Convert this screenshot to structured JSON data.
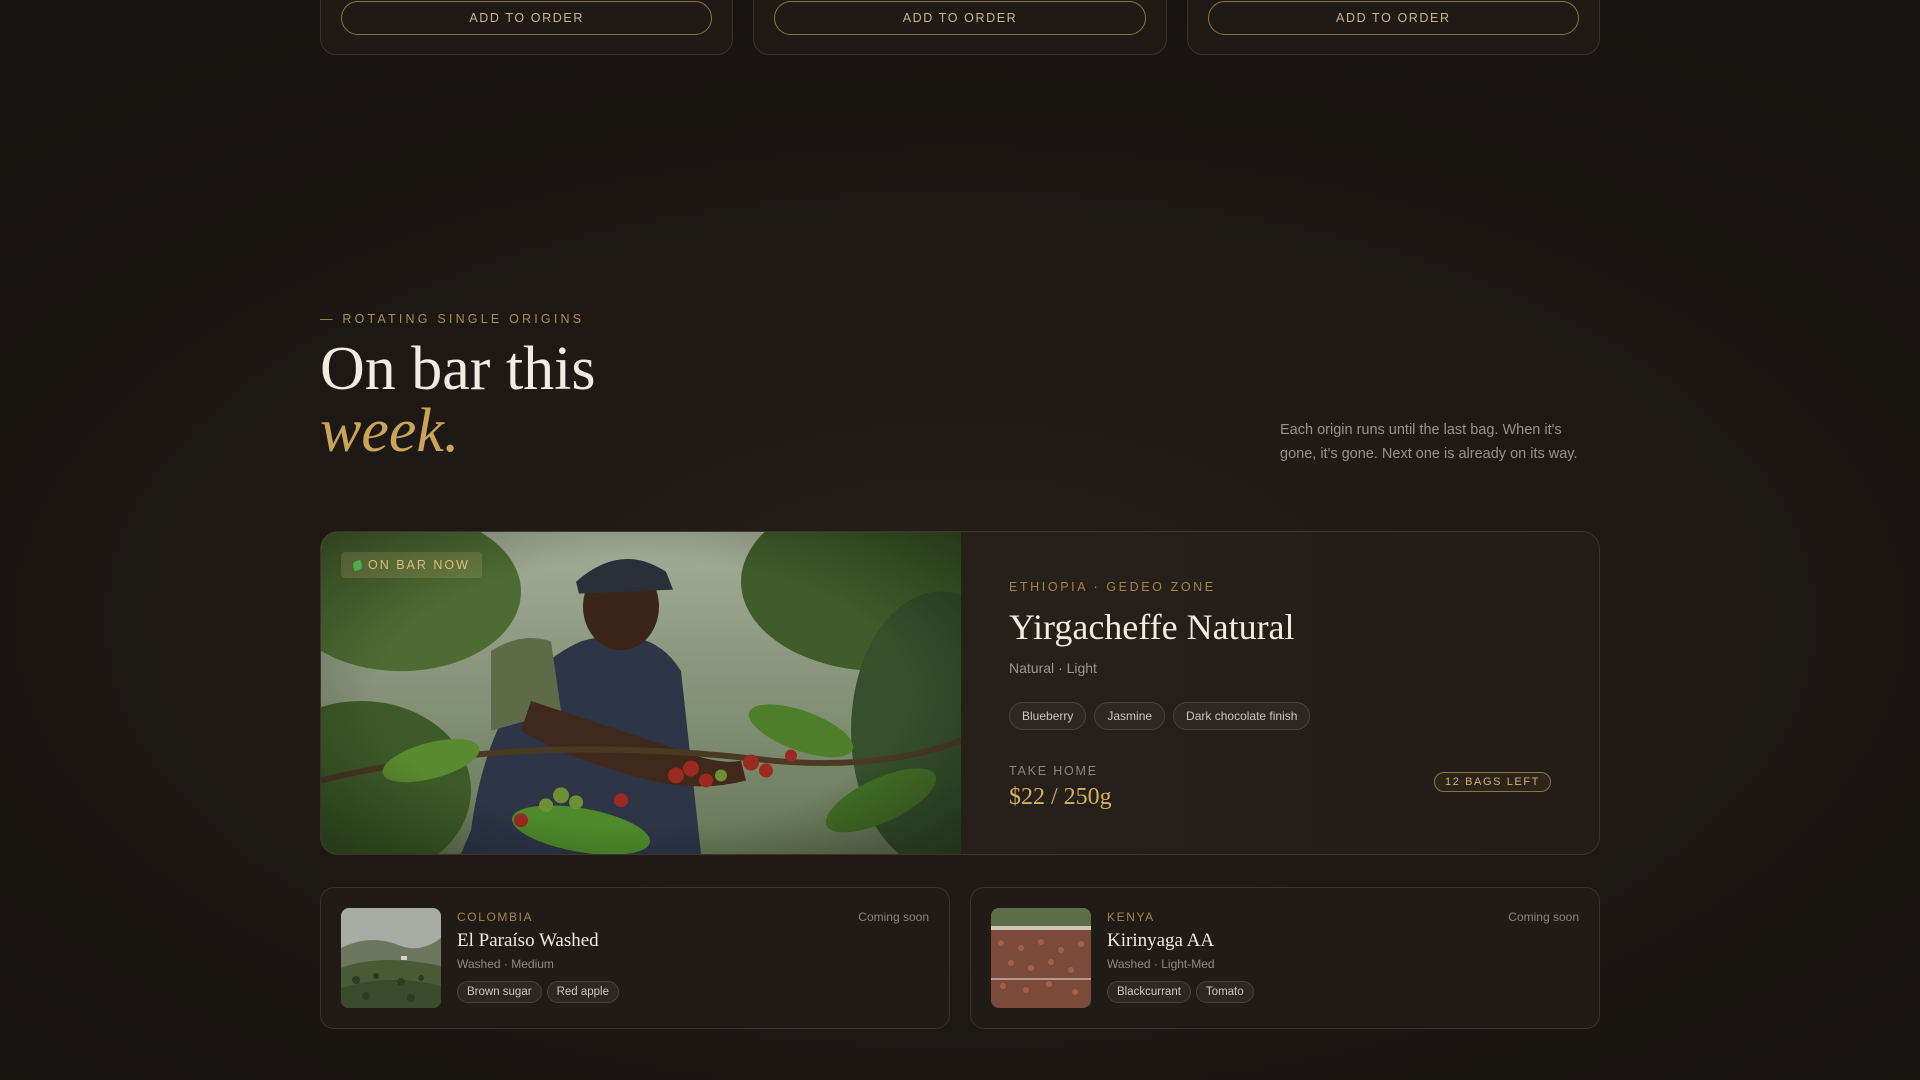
{
  "top_cards": [
    {
      "button_label": "ADD TO ORDER"
    },
    {
      "button_label": "ADD TO ORDER"
    },
    {
      "button_label": "ADD TO ORDER"
    }
  ],
  "section": {
    "eyebrow": "— ROTATING SINGLE ORIGINS",
    "heading_line1": "On bar this",
    "heading_line2": "week.",
    "intro": "Each origin runs until the last bag. When it's gone, it's gone. Next one is already on its way."
  },
  "featured": {
    "badge": "ON BAR NOW",
    "origin": "ETHIOPIA · GEDEO ZONE",
    "name": "Yirgacheffe Natural",
    "process": "Natural · Light",
    "tags": [
      "Blueberry",
      "Jasmine",
      "Dark chocolate finish"
    ],
    "take_home_label": "TAKE HOME",
    "price": "$22 / 250g",
    "stock": "12 BAGS LEFT"
  },
  "upcoming": [
    {
      "origin": "COLOMBIA",
      "name": "El Paraíso Washed",
      "process": "Washed · Medium",
      "tags": [
        "Brown sugar",
        "Red apple"
      ],
      "status": "Coming soon"
    },
    {
      "origin": "KENYA",
      "name": "Kirinyaga AA",
      "process": "Washed · Light-Med",
      "tags": [
        "Blackcurrant",
        "Tomato"
      ],
      "status": "Coming soon"
    }
  ],
  "colors": {
    "accent_gold": "#c9a559",
    "background": "#1a1512",
    "badge_green": "#4caf50"
  }
}
